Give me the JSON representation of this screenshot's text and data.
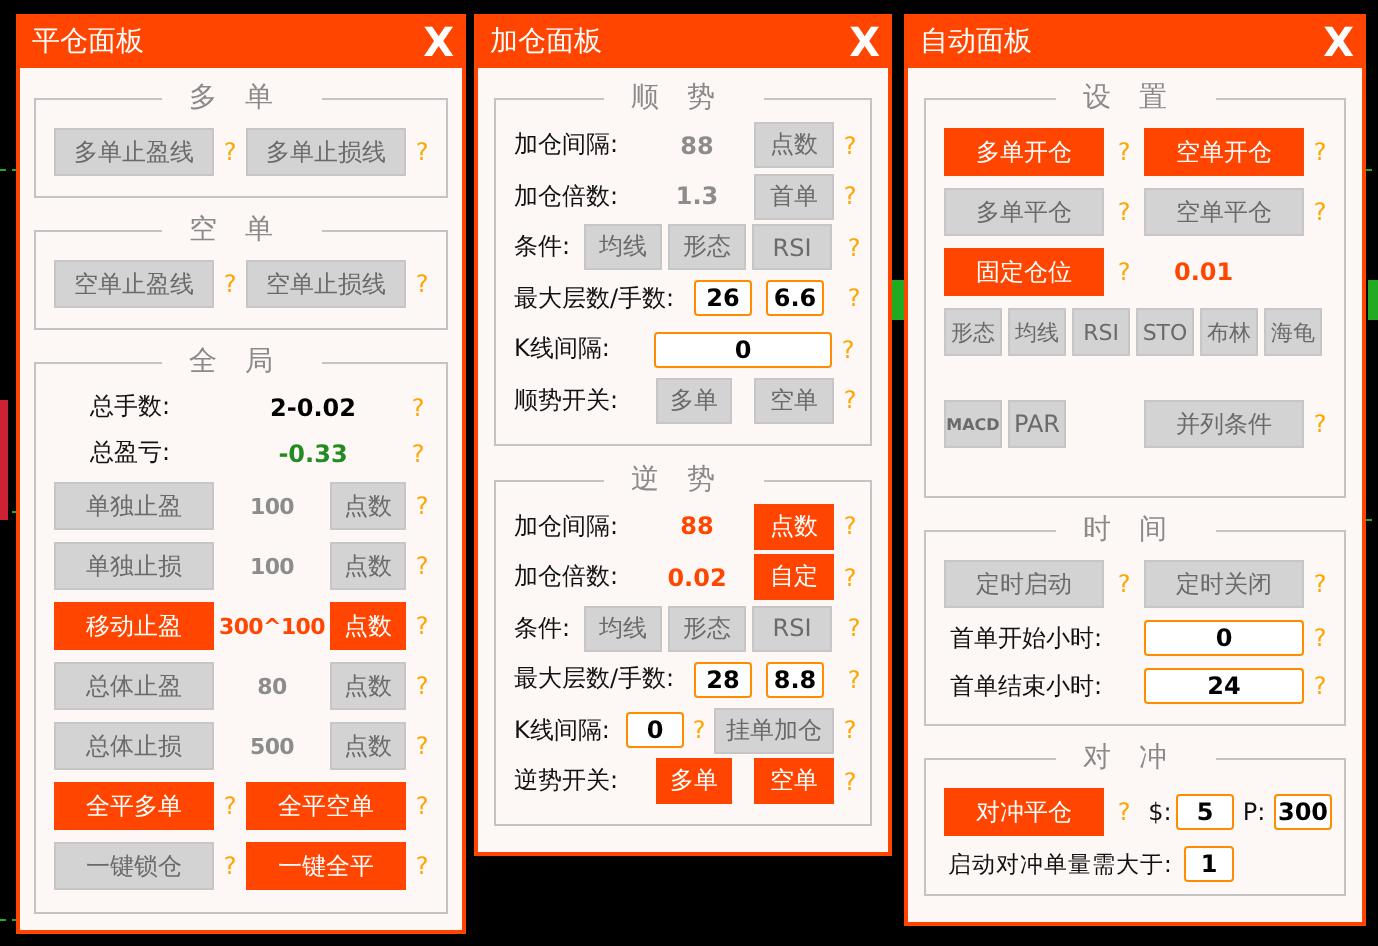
{
  "panels": [
    {
      "title": "平仓面板",
      "close": "X",
      "groups": [
        {
          "title": "多单",
          "rows": [
            {
              "kind": "pair",
              "items": [
                {
                  "kind": "button",
                  "label": "多单止盈线",
                  "on": false
                },
                {
                  "kind": "help",
                  "text": "?"
                },
                {
                  "kind": "button",
                  "label": "多单止损线",
                  "on": false
                },
                {
                  "kind": "help",
                  "text": "?"
                }
              ]
            }
          ]
        },
        {
          "title": "空单",
          "rows": [
            {
              "kind": "pair",
              "items": [
                {
                  "kind": "button",
                  "label": "空单止盈线",
                  "on": false
                },
                {
                  "kind": "help",
                  "text": "?"
                },
                {
                  "kind": "button",
                  "label": "空单止损线",
                  "on": false
                },
                {
                  "kind": "help",
                  "text": "?"
                }
              ]
            }
          ]
        },
        {
          "title": "全局",
          "rows": [
            {
              "kind": "stat",
              "items": [
                {
                  "kind": "label",
                  "text": "总手数:"
                },
                {
                  "kind": "value",
                  "text": "2-0.02",
                  "color": "#000000"
                },
                {
                  "kind": "help",
                  "text": "?"
                }
              ]
            },
            {
              "kind": "stat",
              "items": [
                {
                  "kind": "label",
                  "text": "总盈亏:"
                },
                {
                  "kind": "value",
                  "text": "-0.33",
                  "color": "#228b22"
                },
                {
                  "kind": "help",
                  "text": "?"
                }
              ]
            },
            {
              "kind": "setting",
              "items": [
                {
                  "kind": "button",
                  "label": "单独止盈",
                  "on": false
                },
                {
                  "kind": "value",
                  "text": "100",
                  "color": "#8c8c8c"
                },
                {
                  "kind": "button",
                  "label": "点数",
                  "on": false
                },
                {
                  "kind": "help",
                  "text": "?"
                }
              ]
            },
            {
              "kind": "setting",
              "items": [
                {
                  "kind": "button",
                  "label": "单独止损",
                  "on": false
                },
                {
                  "kind": "value",
                  "text": "100",
                  "color": "#8c8c8c"
                },
                {
                  "kind": "button",
                  "label": "点数",
                  "on": false
                },
                {
                  "kind": "help",
                  "text": "?"
                }
              ]
            },
            {
              "kind": "setting",
              "items": [
                {
                  "kind": "button",
                  "label": "移动止盈",
                  "on": true
                },
                {
                  "kind": "value",
                  "text": "300^100",
                  "color": "#ff4500"
                },
                {
                  "kind": "button",
                  "label": "点数",
                  "on": true
                },
                {
                  "kind": "help",
                  "text": "?"
                }
              ]
            },
            {
              "kind": "setting",
              "items": [
                {
                  "kind": "button",
                  "label": "总体止盈",
                  "on": false
                },
                {
                  "kind": "value",
                  "text": "80",
                  "color": "#8c8c8c"
                },
                {
                  "kind": "button",
                  "label": "点数",
                  "on": false
                },
                {
                  "kind": "help",
                  "text": "?"
                }
              ]
            },
            {
              "kind": "setting",
              "items": [
                {
                  "kind": "button",
                  "label": "总体止损",
                  "on": false
                },
                {
                  "kind": "value",
                  "text": "500",
                  "color": "#8c8c8c"
                },
                {
                  "kind": "button",
                  "label": "点数",
                  "on": false
                },
                {
                  "kind": "help",
                  "text": "?"
                }
              ]
            },
            {
              "kind": "pair",
              "items": [
                {
                  "kind": "button",
                  "label": "全平多单",
                  "on": true
                },
                {
                  "kind": "help",
                  "text": "?"
                },
                {
                  "kind": "button",
                  "label": "全平空单",
                  "on": true
                },
                {
                  "kind": "help",
                  "text": "?"
                }
              ]
            },
            {
              "kind": "pair",
              "items": [
                {
                  "kind": "button",
                  "label": "一键锁仓",
                  "on": false
                },
                {
                  "kind": "help",
                  "text": "?"
                },
                {
                  "kind": "button",
                  "label": "一键全平",
                  "on": true
                },
                {
                  "kind": "help",
                  "text": "?"
                }
              ]
            }
          ]
        }
      ]
    },
    {
      "title": "加仓面板",
      "close": "X",
      "groups": [
        {
          "title": "顺势",
          "rows": [
            {
              "kind": "param",
              "items": [
                {
                  "kind": "label",
                  "text": "加仓间隔:"
                },
                {
                  "kind": "value",
                  "text": "88",
                  "color": "#8c8c8c"
                },
                {
                  "kind": "button",
                  "label": "点数",
                  "on": false
                },
                {
                  "kind": "help",
                  "text": "?"
                }
              ]
            },
            {
              "kind": "param",
              "items": [
                {
                  "kind": "label",
                  "text": "加仓倍数:"
                },
                {
                  "kind": "value",
                  "text": "1.3",
                  "color": "#8c8c8c"
                },
                {
                  "kind": "button",
                  "label": "首单",
                  "on": false
                },
                {
                  "kind": "help",
                  "text": "?"
                }
              ]
            },
            {
              "kind": "conditions",
              "items": [
                {
                  "kind": "label",
                  "text": "条件:"
                },
                {
                  "kind": "button",
                  "label": "均线",
                  "on": false
                },
                {
                  "kind": "button",
                  "label": "形态",
                  "on": false
                },
                {
                  "kind": "button",
                  "label": "RSI",
                  "on": false
                },
                {
                  "kind": "help",
                  "text": "?"
                }
              ]
            },
            {
              "kind": "limits",
              "items": [
                {
                  "kind": "label",
                  "text": "最大层数/手数:"
                },
                {
                  "kind": "input",
                  "value": "26"
                },
                {
                  "kind": "input",
                  "value": "6.6"
                },
                {
                  "kind": "help",
                  "text": "?"
                }
              ]
            },
            {
              "kind": "kline",
              "items": [
                {
                  "kind": "label",
                  "text": "K线间隔:"
                },
                {
                  "kind": "input",
                  "value": "0"
                },
                {
                  "kind": "help",
                  "text": "?"
                }
              ]
            },
            {
              "kind": "switch",
              "items": [
                {
                  "kind": "label",
                  "text": "顺势开关:"
                },
                {
                  "kind": "button",
                  "label": "多单",
                  "on": false
                },
                {
                  "kind": "button",
                  "label": "空单",
                  "on": false
                },
                {
                  "kind": "help",
                  "text": "?"
                }
              ]
            }
          ]
        },
        {
          "title": "逆势",
          "rows": [
            {
              "kind": "param",
              "items": [
                {
                  "kind": "label",
                  "text": "加仓间隔:"
                },
                {
                  "kind": "value",
                  "text": "88",
                  "color": "#ff4500"
                },
                {
                  "kind": "button",
                  "label": "点数",
                  "on": true
                },
                {
                  "kind": "help",
                  "text": "?"
                }
              ]
            },
            {
              "kind": "param",
              "items": [
                {
                  "kind": "label",
                  "text": "加仓倍数:"
                },
                {
                  "kind": "value",
                  "text": "0.02",
                  "color": "#ff4500"
                },
                {
                  "kind": "button",
                  "label": "自定",
                  "on": true
                },
                {
                  "kind": "help",
                  "text": "?"
                }
              ]
            },
            {
              "kind": "conditions",
              "items": [
                {
                  "kind": "label",
                  "text": "条件:"
                },
                {
                  "kind": "button",
                  "label": "均线",
                  "on": false
                },
                {
                  "kind": "button",
                  "label": "形态",
                  "on": false
                },
                {
                  "kind": "button",
                  "label": "RSI",
                  "on": false
                },
                {
                  "kind": "help",
                  "text": "?"
                }
              ]
            },
            {
              "kind": "limits",
              "items": [
                {
                  "kind": "label",
                  "text": "最大层数/手数:"
                },
                {
                  "kind": "input",
                  "value": "28"
                },
                {
                  "kind": "input",
                  "value": "8.8"
                },
                {
                  "kind": "help",
                  "text": "?"
                }
              ]
            },
            {
              "kind": "kline-pending",
              "items": [
                {
                  "kind": "label",
                  "text": "K线间隔:"
                },
                {
                  "kind": "input",
                  "value": "0"
                },
                {
                  "kind": "help",
                  "text": "?"
                },
                {
                  "kind": "button",
                  "label": "挂单加仓",
                  "on": false
                },
                {
                  "kind": "help",
                  "text": "?"
                }
              ]
            },
            {
              "kind": "switch",
              "items": [
                {
                  "kind": "label",
                  "text": "逆势开关:"
                },
                {
                  "kind": "button",
                  "label": "多单",
                  "on": true
                },
                {
                  "kind": "button",
                  "label": "空单",
                  "on": true
                },
                {
                  "kind": "help",
                  "text": "?"
                }
              ]
            }
          ]
        }
      ]
    },
    {
      "title": "自动面板",
      "close": "X",
      "groups": [
        {
          "title": "设置",
          "rows": [
            {
              "kind": "pair",
              "items": [
                {
                  "kind": "button",
                  "label": "多单开仓",
                  "on": true
                },
                {
                  "kind": "help",
                  "text": "?"
                },
                {
                  "kind": "button",
                  "label": "空单开仓",
                  "on": true
                },
                {
                  "kind": "help",
                  "text": "?"
                }
              ]
            },
            {
              "kind": "pair",
              "items": [
                {
                  "kind": "button",
                  "label": "多单平仓",
                  "on": false
                },
                {
                  "kind": "help",
                  "text": "?"
                },
                {
                  "kind": "button",
                  "label": "空单平仓",
                  "on": false
                },
                {
                  "kind": "help",
                  "text": "?"
                }
              ]
            },
            {
              "kind": "fixed",
              "items": [
                {
                  "kind": "button",
                  "label": "固定仓位",
                  "on": true
                },
                {
                  "kind": "help",
                  "text": "?"
                },
                {
                  "kind": "value",
                  "text": "0.01",
                  "color": "#ff4500"
                }
              ]
            },
            {
              "kind": "indicators",
              "items": [
                {
                  "kind": "button",
                  "label": "形态",
                  "on": false
                },
                {
                  "kind": "button",
                  "label": "均线",
                  "on": false
                },
                {
                  "kind": "button",
                  "label": "RSI",
                  "on": false
                },
                {
                  "kind": "button",
                  "label": "STO",
                  "on": false
                },
                {
                  "kind": "button",
                  "label": "布林",
                  "on": false
                },
                {
                  "kind": "button",
                  "label": "海龟",
                  "on": false
                }
              ]
            },
            {
              "kind": "extra",
              "items": [
                {
                  "kind": "button",
                  "label": "MACD",
                  "on": false
                },
                {
                  "kind": "button",
                  "label": "PAR",
                  "on": false
                },
                {
                  "kind": "button",
                  "label": "并列条件",
                  "on": false
                },
                {
                  "kind": "help",
                  "text": "?"
                }
              ]
            }
          ]
        },
        {
          "title": "时间",
          "rows": [
            {
              "kind": "pair",
              "items": [
                {
                  "kind": "button",
                  "label": "定时启动",
                  "on": false
                },
                {
                  "kind": "help",
                  "text": "?"
                },
                {
                  "kind": "button",
                  "label": "定时关闭",
                  "on": false
                },
                {
                  "kind": "help",
                  "text": "?"
                }
              ]
            },
            {
              "kind": "hours",
              "items": [
                {
                  "kind": "label",
                  "text": "首单开始小时:"
                },
                {
                  "kind": "input",
                  "value": "0"
                },
                {
                  "kind": "help",
                  "text": "?"
                }
              ]
            },
            {
              "kind": "hours",
              "items": [
                {
                  "kind": "label",
                  "text": "首单结束小时:"
                },
                {
                  "kind": "input",
                  "value": "24"
                },
                {
                  "kind": "help",
                  "text": "?"
                }
              ]
            }
          ]
        },
        {
          "title": "对冲",
          "rows": [
            {
              "kind": "hedge",
              "items": [
                {
                  "kind": "button",
                  "label": "对冲平仓",
                  "on": true
                },
                {
                  "kind": "help",
                  "text": "?"
                },
                {
                  "kind": "label",
                  "text": "$:"
                },
                {
                  "kind": "input",
                  "value": "5"
                },
                {
                  "kind": "label",
                  "text": "P:"
                },
                {
                  "kind": "input",
                  "value": "300"
                }
              ]
            },
            {
              "kind": "threshold",
              "items": [
                {
                  "kind": "label",
                  "text": "启动对冲单量需大于:"
                },
                {
                  "kind": "input",
                  "value": "1"
                }
              ]
            }
          ]
        }
      ]
    }
  ]
}
